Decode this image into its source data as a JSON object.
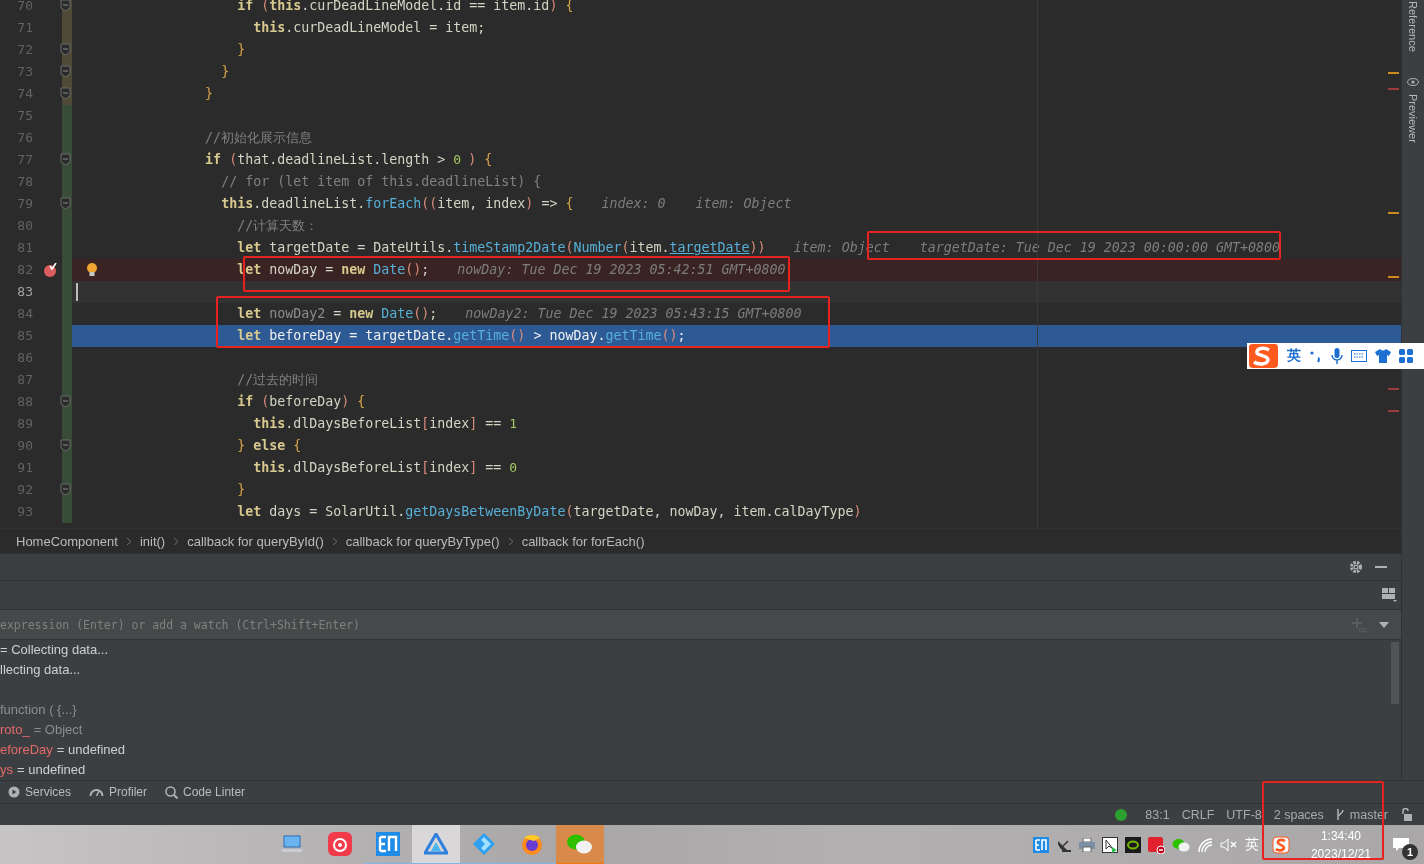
{
  "editor": {
    "lines": [
      {
        "number": "70",
        "color": "#4f4a35",
        "fold": true,
        "breakpoint": false,
        "caret": false,
        "execution": false,
        "intention": false,
        "code": [
          {
            "kind": "keyword",
            "text": "                  if"
          },
          {
            "kind": "paren",
            "text": " ("
          },
          {
            "kind": "keyword",
            "text": "this"
          },
          {
            "kind": "identifier",
            "text": ".curDeadLineModel.id == item.id"
          },
          {
            "kind": "paren",
            "text": ")"
          },
          {
            "kind": "brace",
            "text": " {"
          }
        ]
      },
      {
        "number": "71",
        "color": "#4f4a35",
        "fold": false,
        "breakpoint": false,
        "caret": false,
        "execution": false,
        "intention": false,
        "code": [
          {
            "kind": "keyword",
            "text": "                    this"
          },
          {
            "kind": "identifier",
            "text": ".curDeadLineModel = item;"
          }
        ]
      },
      {
        "number": "72",
        "color": "#4f4a35",
        "fold": true,
        "breakpoint": false,
        "caret": false,
        "execution": false,
        "intention": false,
        "code": [
          {
            "kind": "brace",
            "text": "                  }"
          }
        ]
      },
      {
        "number": "73",
        "color": "#4f4a35",
        "fold": true,
        "breakpoint": false,
        "caret": false,
        "execution": false,
        "intention": false,
        "code": [
          {
            "kind": "brace",
            "text": "                }"
          }
        ]
      },
      {
        "number": "74",
        "color": "#4f4a35",
        "fold": true,
        "breakpoint": false,
        "caret": false,
        "execution": false,
        "intention": false,
        "code": [
          {
            "kind": "brace",
            "text": "              }"
          }
        ]
      },
      {
        "number": "75",
        "color": "#384c38",
        "fold": false,
        "breakpoint": false,
        "caret": false,
        "execution": false,
        "intention": false
      },
      {
        "number": "76",
        "color": "#384c38",
        "fold": false,
        "breakpoint": false,
        "caret": false,
        "execution": false,
        "intention": false,
        "code": [
          {
            "kind": "comment",
            "text": "              //初始化展示信息"
          }
        ]
      },
      {
        "number": "77",
        "color": "#384c38",
        "fold": true,
        "breakpoint": false,
        "caret": false,
        "execution": false,
        "intention": false,
        "code": [
          {
            "kind": "keyword",
            "text": "              if"
          },
          {
            "kind": "paren",
            "text": " ("
          },
          {
            "kind": "identifier",
            "text": "that.deadlineList.length > "
          },
          {
            "kind": "number",
            "text": "0"
          },
          {
            "kind": "paren",
            "text": ")"
          },
          {
            "kind": "brace",
            "text": " {"
          }
        ]
      },
      {
        "number": "78",
        "color": "#384c38",
        "fold": false,
        "breakpoint": false,
        "caret": false,
        "execution": false,
        "intention": false,
        "code": [
          {
            "kind": "comment",
            "text": "                // for (let item of this.deadlineList) {"
          }
        ]
      },
      {
        "number": "79",
        "color": "#384c38",
        "fold": true,
        "breakpoint": false,
        "caret": false,
        "execution": false,
        "intention": false,
        "code": [
          {
            "kind": "keyword",
            "text": "                this"
          },
          {
            "kind": "identifier",
            "text": ".deadlineList."
          },
          {
            "kind": "function",
            "text": "forEach"
          },
          {
            "kind": "paren",
            "text": "(("
          },
          {
            "kind": "identifier",
            "text": "item, index"
          },
          {
            "kind": "paren",
            "text": ")"
          },
          {
            "kind": "identifier",
            "text": " => "
          },
          {
            "kind": "brace",
            "text": "{"
          }
        ],
        "hints": [
          "index: 0",
          "item: Object"
        ]
      },
      {
        "number": "80",
        "color": "#384c38",
        "fold": false,
        "breakpoint": false,
        "caret": false,
        "execution": false,
        "intention": false,
        "code": [
          {
            "kind": "comment",
            "text": "                  //计算天数："
          }
        ]
      },
      {
        "number": "81",
        "color": "#384c38",
        "fold": false,
        "breakpoint": false,
        "caret": false,
        "execution": false,
        "intention": false,
        "code": [
          {
            "kind": "keyword",
            "text": "                  let"
          },
          {
            "kind": "identifier",
            "text": " targetDate = DateUtils."
          },
          {
            "kind": "function",
            "text": "timeStamp2Date"
          },
          {
            "kind": "paren",
            "text": "("
          },
          {
            "kind": "function",
            "text": "Number"
          },
          {
            "kind": "paren",
            "text": "("
          },
          {
            "kind": "identifier",
            "text": "item."
          },
          {
            "kind": "field_link",
            "text": "targetDate"
          },
          {
            "kind": "paren",
            "text": "))"
          }
        ],
        "hints": [
          "item: Object",
          "targetDate: Tue Dec 19 2023 00:00:00 GMT+0800"
        ]
      },
      {
        "number": "82",
        "color": "#384c38",
        "fold": false,
        "breakpoint": true,
        "caret": false,
        "execution": false,
        "intention": true,
        "code": [
          {
            "kind": "keyword",
            "text": "                  let"
          },
          {
            "kind": "identifier",
            "text": " nowDay = "
          },
          {
            "kind": "keyword",
            "text": "new"
          },
          {
            "kind": "function",
            "text": " Date"
          },
          {
            "kind": "paren",
            "text": "()"
          },
          {
            "kind": "identifier",
            "text": ";"
          }
        ],
        "hints": [
          "nowDay: Tue Dec 19 2023 05:42:51 GMT+0800"
        ]
      },
      {
        "number": "83",
        "color": "#384c38",
        "fold": false,
        "breakpoint": false,
        "caret": true,
        "execution": false,
        "intention": false
      },
      {
        "number": "84",
        "color": "#384c38",
        "fold": false,
        "breakpoint": false,
        "caret": false,
        "execution": false,
        "intention": false,
        "code": [
          {
            "kind": "keyword",
            "text": "                  let"
          },
          {
            "kind": "unused",
            "text": " nowDay2"
          },
          {
            "kind": "identifier",
            "text": " = "
          },
          {
            "kind": "keyword",
            "text": "new"
          },
          {
            "kind": "function",
            "text": " Date"
          },
          {
            "kind": "paren",
            "text": "()"
          },
          {
            "kind": "identifier",
            "text": ";"
          }
        ],
        "hints": [
          "nowDay2: Tue Dec 19 2023 05:43:15 GMT+0800"
        ]
      },
      {
        "number": "85",
        "color": "#384c38",
        "fold": false,
        "breakpoint": false,
        "caret": false,
        "execution": true,
        "intention": false,
        "code": [
          {
            "kind": "keyword",
            "text": "                  let"
          },
          {
            "kind": "identifier",
            "text": " beforeDay = targetDate."
          },
          {
            "kind": "function",
            "text": "getTime"
          },
          {
            "kind": "paren",
            "text": "()"
          },
          {
            "kind": "identifier",
            "text": " > nowDay."
          },
          {
            "kind": "function",
            "text": "getTime"
          },
          {
            "kind": "paren",
            "text": "()"
          },
          {
            "kind": "identifier",
            "text": ";"
          }
        ]
      },
      {
        "number": "86",
        "color": "#384c38",
        "fold": false,
        "breakpoint": false,
        "caret": false,
        "execution": false,
        "intention": false
      },
      {
        "number": "87",
        "color": "#384c38",
        "fold": false,
        "breakpoint": false,
        "caret": false,
        "execution": false,
        "intention": false,
        "code": [
          {
            "kind": "comment",
            "text": "                  //过去的时间"
          }
        ]
      },
      {
        "number": "88",
        "color": "#384c38",
        "fold": true,
        "breakpoint": false,
        "caret": false,
        "execution": false,
        "intention": false,
        "code": [
          {
            "kind": "keyword",
            "text": "                  if"
          },
          {
            "kind": "paren",
            "text": " ("
          },
          {
            "kind": "identifier",
            "text": "beforeDay"
          },
          {
            "kind": "paren",
            "text": ")"
          },
          {
            "kind": "brace",
            "text": " {"
          }
        ]
      },
      {
        "number": "89",
        "color": "#384c38",
        "fold": false,
        "breakpoint": false,
        "caret": false,
        "execution": false,
        "intention": false,
        "code": [
          {
            "kind": "keyword",
            "text": "                    this"
          },
          {
            "kind": "identifier",
            "text": ".dlDaysBeforeList"
          },
          {
            "kind": "bracket",
            "text": "["
          },
          {
            "kind": "identifier",
            "text": "index"
          },
          {
            "kind": "bracket",
            "text": "]"
          },
          {
            "kind": "identifier",
            "text": " == "
          },
          {
            "kind": "number",
            "text": "1"
          }
        ]
      },
      {
        "number": "90",
        "color": "#384c38",
        "fold": true,
        "breakpoint": false,
        "caret": false,
        "execution": false,
        "intention": false,
        "code": [
          {
            "kind": "brace",
            "text": "                  }"
          },
          {
            "kind": "keyword",
            "text": " else"
          },
          {
            "kind": "brace",
            "text": " {"
          }
        ]
      },
      {
        "number": "91",
        "color": "#384c38",
        "fold": false,
        "breakpoint": false,
        "caret": false,
        "execution": false,
        "intention": false,
        "code": [
          {
            "kind": "keyword",
            "text": "                    this"
          },
          {
            "kind": "identifier",
            "text": ".dlDaysBeforeList"
          },
          {
            "kind": "bracket",
            "text": "["
          },
          {
            "kind": "identifier",
            "text": "index"
          },
          {
            "kind": "bracket",
            "text": "]"
          },
          {
            "kind": "identifier",
            "text": " == "
          },
          {
            "kind": "number",
            "text": "0"
          }
        ]
      },
      {
        "number": "92",
        "color": "#384c38",
        "fold": true,
        "breakpoint": false,
        "caret": false,
        "execution": false,
        "intention": false,
        "code": [
          {
            "kind": "brace",
            "text": "                  }"
          }
        ]
      },
      {
        "number": "93",
        "color": "#384c38",
        "fold": false,
        "breakpoint": false,
        "caret": false,
        "execution": false,
        "intention": false,
        "code": [
          {
            "kind": "keyword",
            "text": "                  let"
          },
          {
            "kind": "identifier",
            "text": " days = SolarUtil."
          },
          {
            "kind": "function",
            "text": "getDaysBetweenByDate"
          },
          {
            "kind": "paren",
            "text": "("
          },
          {
            "kind": "identifier",
            "text": "targetDate, nowDay, item.calDayType"
          },
          {
            "kind": "paren",
            "text": ")"
          }
        ]
      }
    ]
  },
  "input_method_bar": {
    "language": "英"
  },
  "side_tabs": [
    "Reference",
    "Previewer"
  ],
  "breadcrumbs": [
    "HomeComponent",
    "init()",
    "callback for queryById()",
    "callback for queryByType()",
    "callback for forEach()"
  ],
  "debug_panel": {
    "evaluate": {
      "placeholder": "expression (Enter) or add a watch (Ctrl+Shift+Enter)"
    },
    "watch_results": [
      {
        "value": "= Collecting data..."
      },
      {
        "value": "llecting data..."
      }
    ],
    "variables": [
      {
        "kind": "object",
        "value": "function ( {...}"
      },
      {
        "kind": "object",
        "name": "roto_",
        "value": "= Object"
      },
      {
        "kind": "primitive",
        "name": "eforeDay",
        "value": "= undefined"
      },
      {
        "kind": "primitive",
        "name": "ys",
        "value": "= undefined"
      }
    ]
  },
  "tool_windows": [
    {
      "kind": "services",
      "label": "Services"
    },
    {
      "kind": "profiler",
      "label": "Profiler"
    },
    {
      "kind": "linter",
      "label": "Code Linter"
    }
  ],
  "status_bar": {
    "position": "83:1",
    "line_separator": "CRLF",
    "encoding": "UTF-8",
    "indent": "2 spaces",
    "branch": "master"
  },
  "taskbar": {
    "apps": [
      {
        "kind": "laptop",
        "selected": false,
        "attention": false,
        "running": false
      },
      {
        "kind": "music",
        "selected": false,
        "attention": false,
        "running": false
      },
      {
        "kind": "dictionary",
        "selected": false,
        "attention": false,
        "running": true
      },
      {
        "kind": "triangle",
        "selected": true,
        "attention": false,
        "running": true
      },
      {
        "kind": "diamond",
        "selected": false,
        "attention": false,
        "running": true
      },
      {
        "kind": "browser",
        "selected": false,
        "attention": false,
        "running": true
      },
      {
        "kind": "chat",
        "selected": false,
        "attention": true,
        "running": true
      }
    ],
    "tray": [
      {
        "kind": "dictionary"
      },
      {
        "kind": "satellite"
      },
      {
        "kind": "printer"
      },
      {
        "kind": "cursor"
      },
      {
        "kind": "gpu"
      },
      {
        "kind": "notes"
      },
      {
        "kind": "chat"
      },
      {
        "kind": "wifi"
      },
      {
        "kind": "mute"
      }
    ],
    "language": "英",
    "time": "1:34:40",
    "date": "2023/12/21",
    "notification_count": "1"
  }
}
